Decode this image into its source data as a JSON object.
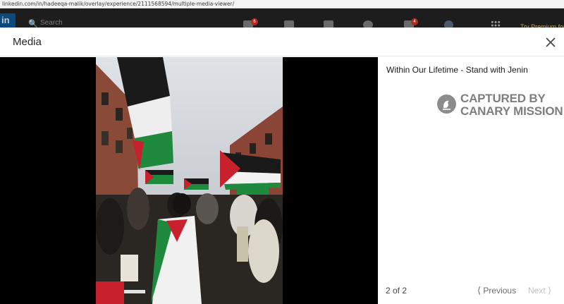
{
  "browser": {
    "url": "linkedin.com/in/hadeeqa-malik/overlay/experience/2111568594/multiple-media-viewer/"
  },
  "linkedin_header": {
    "logo": "in",
    "search_placeholder": "Search",
    "home_badge": "6",
    "notifications_badge": "4",
    "premium_link": "Try Premium for"
  },
  "modal": {
    "title": "Media",
    "close_icon": "close-icon",
    "media_title": "Within Our Lifetime - Stand with Jenin",
    "watermark": {
      "line1": "CAPTURED BY",
      "line2": "CANARY MISSION"
    },
    "counter": "2 of 2",
    "prev_label": "Previous",
    "next_label": "Next",
    "prev_icon": "chevron-left-icon",
    "next_icon": "chevron-right-icon"
  },
  "colors": {
    "media_background": "#000000",
    "header_dim": "#1d1d1d",
    "badge": "#b22a20",
    "flag_red": "#c8202c",
    "flag_green": "#1f8a3d"
  }
}
